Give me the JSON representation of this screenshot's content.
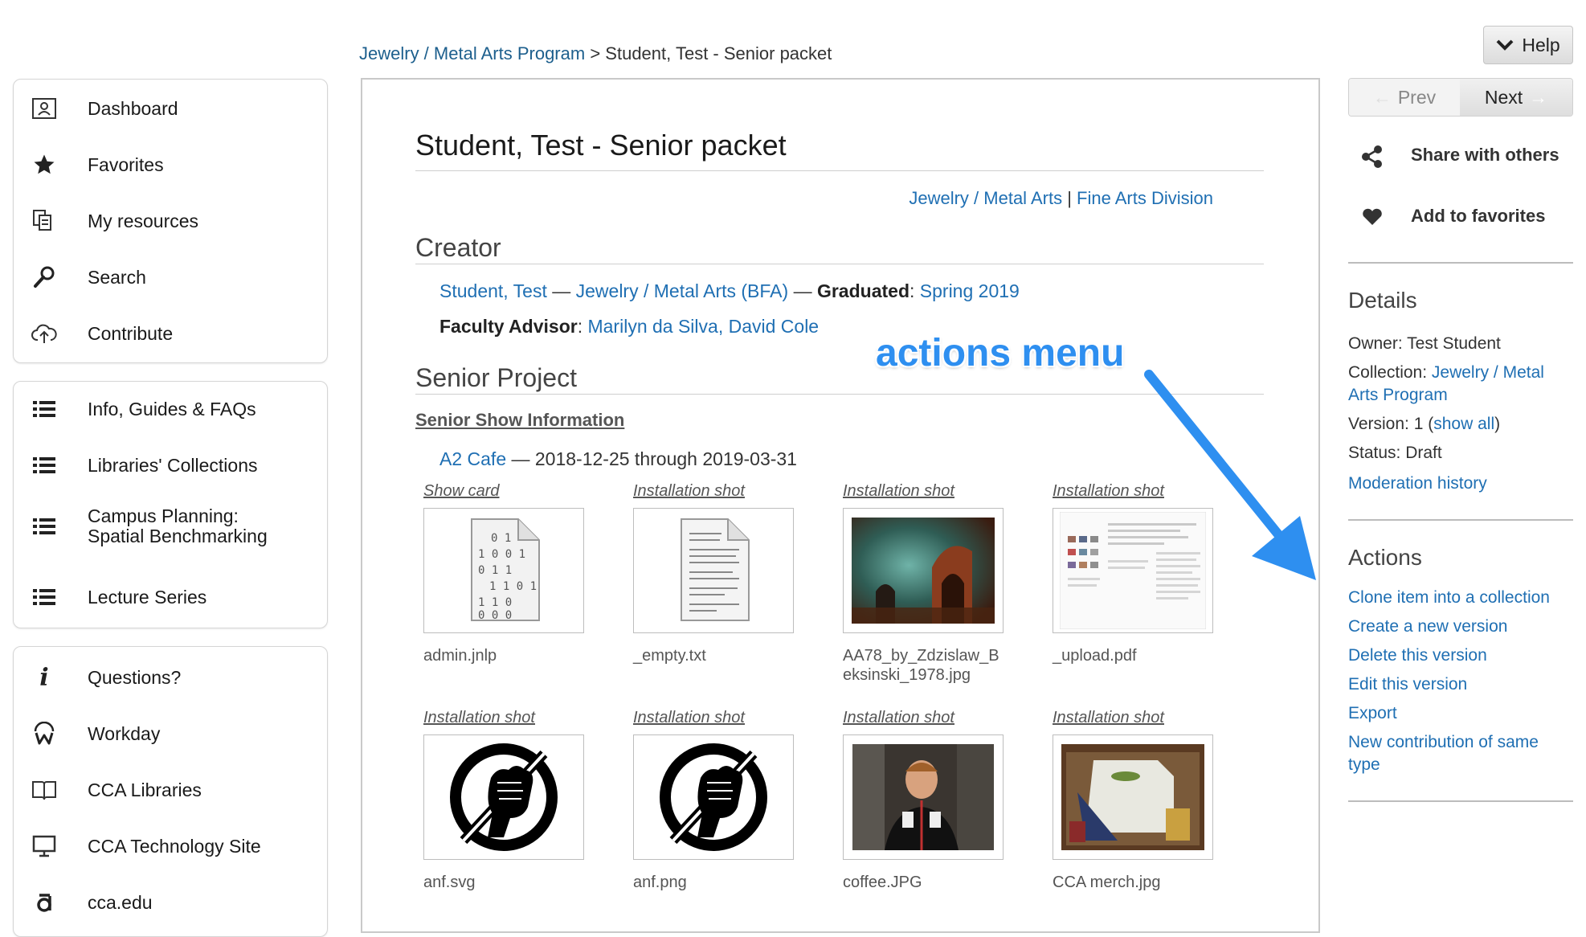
{
  "breadcrumb": {
    "parent": "Jewelry / Metal Arts Program",
    "separator": ">",
    "current": "Student, Test - Senior packet"
  },
  "sidebar": {
    "group1": [
      {
        "label": "Dashboard",
        "icon": "dashboard-icon"
      },
      {
        "label": "Favorites",
        "icon": "star-icon"
      },
      {
        "label": "My resources",
        "icon": "resources-icon"
      },
      {
        "label": "Search",
        "icon": "search-icon"
      },
      {
        "label": "Contribute",
        "icon": "upload-cloud-icon"
      }
    ],
    "group2": [
      {
        "label": "Info, Guides & FAQs",
        "icon": "list-icon"
      },
      {
        "label": "Libraries' Collections",
        "icon": "list-icon"
      },
      {
        "label": "Campus Planning:\nSpatial Benchmarking",
        "icon": "list-icon"
      },
      {
        "label": "Lecture Series",
        "icon": "list-icon"
      }
    ],
    "group3": [
      {
        "label": "Questions?",
        "icon": "info-icon"
      },
      {
        "label": "Workday",
        "icon": "workday-icon"
      },
      {
        "label": "CCA Libraries",
        "icon": "book-icon"
      },
      {
        "label": "CCA Technology Site",
        "icon": "monitor-icon"
      },
      {
        "label": "cca.edu",
        "icon": "cca-logo-icon"
      }
    ]
  },
  "item": {
    "title": "Student, Test - Senior packet",
    "collection_link": "Jewelry / Metal Arts",
    "division_separator": "|",
    "division_link": "Fine Arts Division",
    "creator_heading": "Creator",
    "creator_name": "Student, Test",
    "dash": "—",
    "program": "Jewelry / Metal Arts (BFA)",
    "graduated_label": "Graduated",
    "graduated_value": "Spring 2019",
    "advisor_label": "Faculty Advisor",
    "advisor_value": "Marilyn da Silva, David Cole",
    "project_heading": "Senior Project",
    "show_info_heading": "Senior Show Information",
    "venue": "A2 Cafe",
    "venue_dates": "2018-12-25 through 2019-03-31"
  },
  "attachments": [
    {
      "caption": "Show card",
      "filename": "admin.jnlp",
      "thumb": "binary-file-icon"
    },
    {
      "caption": "Installation shot",
      "filename": "_empty.txt",
      "thumb": "text-file-icon"
    },
    {
      "caption": "Installation shot",
      "filename": "AA78_by_Zdzislaw_Beksinski_1978.jpg",
      "thumb": "painting-image"
    },
    {
      "caption": "Installation shot",
      "filename": "_upload.pdf",
      "thumb": "document-image"
    },
    {
      "caption": "Installation shot",
      "filename": "anf.svg",
      "thumb": "fist-logo-image"
    },
    {
      "caption": "Installation shot",
      "filename": "anf.png",
      "thumb": "fist-logo-image"
    },
    {
      "caption": "Installation shot",
      "filename": "coffee.JPG",
      "thumb": "person-photo"
    },
    {
      "caption": "Installation shot",
      "filename": "CCA merch.jpg",
      "thumb": "merch-photo"
    }
  ],
  "annotation": {
    "text": "actions menu",
    "color": "#2e8ff0"
  },
  "right": {
    "help_label": "Help",
    "prev_label": "Prev",
    "next_label": "Next",
    "share_label": "Share with others",
    "favorite_label": "Add to favorites",
    "details_heading": "Details",
    "owner": "Owner: Test Student",
    "collection_label": "Collection: ",
    "collection_value": "Jewelry / Metal Arts Program",
    "version_label": "Version: 1 (",
    "version_link": "show all",
    "version_end": ")",
    "status": "Status: Draft",
    "moderation": "Moderation history",
    "actions_heading": "Actions",
    "actions": [
      "Clone item into a collection",
      "Create a new version",
      "Delete this version",
      "Edit this version",
      "Export",
      "New contribution of same type"
    ]
  },
  "colors": {
    "link": "#1f6fb3",
    "accent": "#2e8ff0"
  }
}
